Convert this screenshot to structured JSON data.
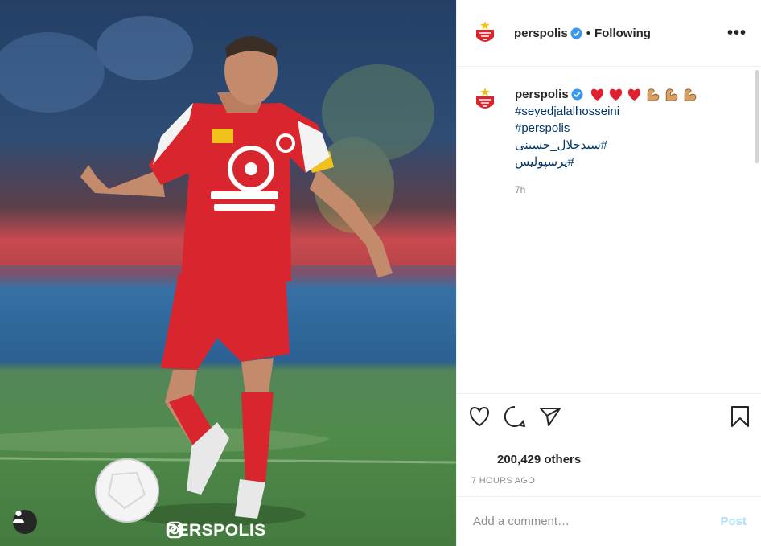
{
  "post": {
    "watermark": "PERSPOLIS",
    "image_icons": {
      "user_tag": "person-icon",
      "watermark": "instagram-icon"
    }
  },
  "header": {
    "username": "perspolis",
    "separator": "•",
    "follow_status": "Following",
    "more": "•••"
  },
  "caption": {
    "username": "perspolis",
    "emojis": [
      "red-heart",
      "red-heart",
      "red-heart",
      "flexed-biceps",
      "flexed-biceps",
      "flexed-biceps"
    ],
    "hashtags": [
      "#seyedjalalhosseini",
      "#perspolis",
      "#سیدجلال_حسینی",
      "#پرسپولیس"
    ],
    "time": "7h"
  },
  "actions": {
    "like": "heart-icon",
    "comment": "comment-icon",
    "share": "paper-plane-icon",
    "save": "bookmark-icon"
  },
  "likes": "200,429 others",
  "timestamp": "7 HOURS AGO",
  "comment": {
    "placeholder": "Add a comment…",
    "post_label": "Post"
  },
  "colors": {
    "link": "#00376b",
    "verified": "#3897f0",
    "post_disabled": "#b2dffc",
    "brand_red": "#d9262e"
  }
}
